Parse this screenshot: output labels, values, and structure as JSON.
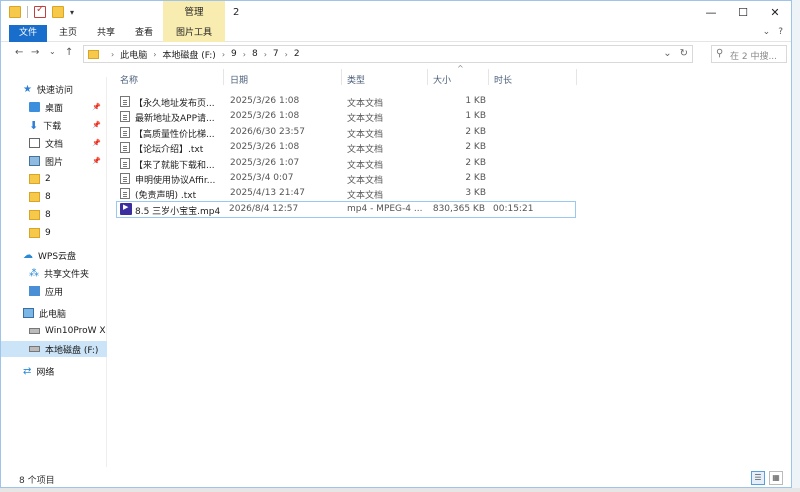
{
  "window": {
    "title": "2",
    "minimize_glyph": "—",
    "maximize_glyph": "☐",
    "close_glyph": "✕"
  },
  "ribbon": {
    "manage_tab": "管理",
    "tabs": [
      "文件",
      "主页",
      "共享",
      "查看",
      "图片工具"
    ],
    "expand_glyph": "⌄",
    "help_glyph": "?"
  },
  "nav": {
    "back": "←",
    "forward": "→",
    "recent": "⌄",
    "up": "↑"
  },
  "address": {
    "crumbs": [
      "此电脑",
      "本地磁盘 (F:)",
      "9",
      "8",
      "7",
      "2"
    ],
    "separator": "›",
    "dropdown": "⌄",
    "refresh": "↻"
  },
  "search": {
    "placeholder": "在 2 中搜..."
  },
  "sidebar": {
    "quick_access": "快速访问",
    "items": [
      {
        "label": "桌面",
        "pinned": true
      },
      {
        "label": "下载",
        "pinned": true
      },
      {
        "label": "文档",
        "pinned": true
      },
      {
        "label": "图片",
        "pinned": true
      },
      {
        "label": "2"
      },
      {
        "label": "8"
      },
      {
        "label": "8"
      },
      {
        "label": "9"
      }
    ],
    "wps_cloud": "WPS云盘",
    "shared_folder": "共享文件夹",
    "apps": "应用",
    "this_pc": "此电脑",
    "drive_c": "Win10ProW X",
    "drive_f": "本地磁盘 (F:)",
    "network": "网络"
  },
  "columns": {
    "name": "名称",
    "date": "日期",
    "type": "类型",
    "size": "大小",
    "length": "时长"
  },
  "files": [
    {
      "name": "【永久地址发布页...",
      "date": "2025/3/26 1:08",
      "type": "文本文档",
      "size": "1 KB",
      "length": "",
      "icon": "text-file-icon"
    },
    {
      "name": "最新地址及APP请...",
      "date": "2025/3/26 1:08",
      "type": "文本文档",
      "size": "1 KB",
      "length": "",
      "icon": "text-file-icon"
    },
    {
      "name": "【高质量性价比梯...",
      "date": "2026/6/30 23:57",
      "type": "文本文档",
      "size": "2 KB",
      "length": "",
      "icon": "text-file-icon"
    },
    {
      "name": "【论坛介绍】.txt",
      "date": "2025/3/26 1:08",
      "type": "文本文档",
      "size": "2 KB",
      "length": "",
      "icon": "text-file-icon"
    },
    {
      "name": "【来了就能下载和...",
      "date": "2025/3/26 1:07",
      "type": "文本文档",
      "size": "2 KB",
      "length": "",
      "icon": "text-file-icon"
    },
    {
      "name": "申明使用协议Affir...",
      "date": "2025/3/4 0:07",
      "type": "文本文档",
      "size": "2 KB",
      "length": "",
      "icon": "text-file-icon"
    },
    {
      "name": "(免责声明) .txt",
      "date": "2025/4/13 21:47",
      "type": "文本文档",
      "size": "3 KB",
      "length": "",
      "icon": "text-file-icon"
    },
    {
      "name": "8.5 三岁小宝宝.mp4",
      "date": "2026/8/4 12:57",
      "type": "mp4 - MPEG-4 ...",
      "size": "830,365 KB",
      "length": "00:15:21",
      "icon": "video-file-icon"
    }
  ],
  "status": {
    "item_count": "8 个项目"
  }
}
